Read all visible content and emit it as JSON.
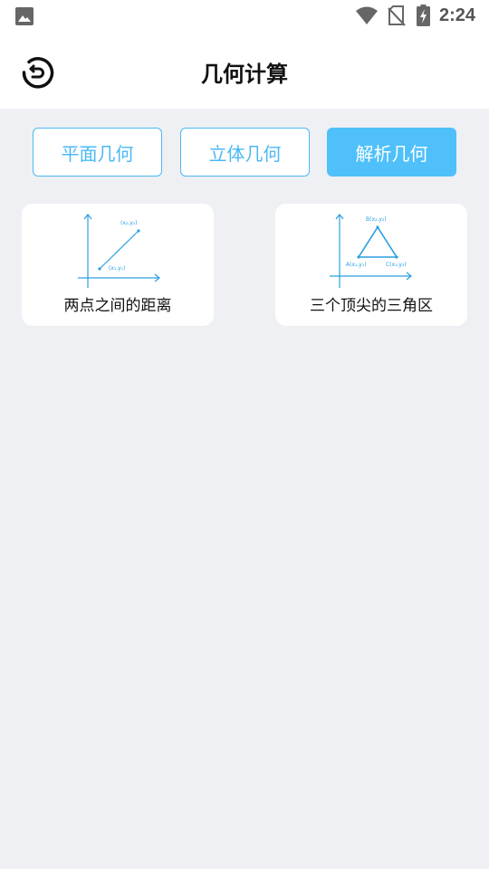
{
  "status_bar": {
    "time": "2:24",
    "icons": [
      "image-icon",
      "wifi-icon",
      "no-sim-icon",
      "battery-charging-icon"
    ]
  },
  "header": {
    "title": "几何计算",
    "back_icon": "back-arrow-icon"
  },
  "tabs": [
    {
      "label": "平面几何",
      "selected": false
    },
    {
      "label": "立体几何",
      "selected": false
    },
    {
      "label": "解析几何",
      "selected": true
    }
  ],
  "cards": [
    {
      "label": "两点之间的距离",
      "points": [
        "(x₂,y₂)",
        "(x₁,y₁)"
      ]
    },
    {
      "label": "三个顶尖的三角区",
      "points": [
        "B(x₂,y₂)",
        "A(x₁,y₁)",
        "C(x₃,y₃)"
      ]
    }
  ],
  "colors": {
    "accent": "#4bb9f4",
    "selected_tab": "#4fc0fa",
    "background": "#eef0f3",
    "diagram_line": "#2a9fe0"
  }
}
